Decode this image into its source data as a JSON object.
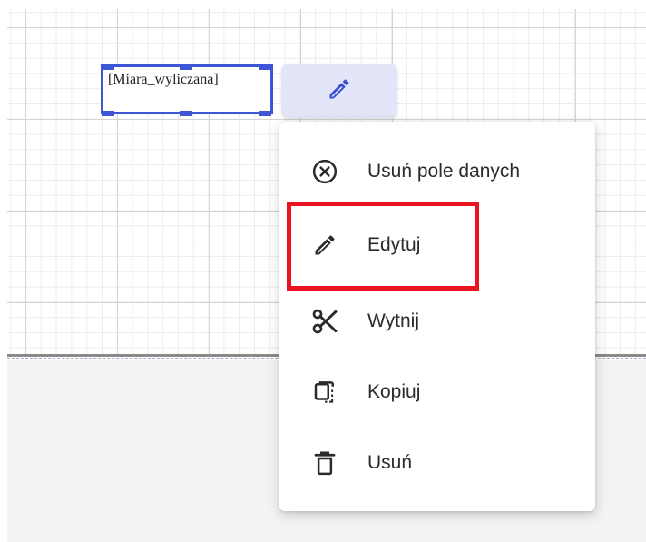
{
  "designer": {
    "field_label": "[Miara_wyliczana]",
    "edit_chip_icon": "pencil-icon"
  },
  "context_menu": {
    "items": [
      {
        "label": "Usuń pole danych",
        "icon": "remove-circle-icon"
      },
      {
        "label": "Edytuj",
        "icon": "pencil-icon"
      },
      {
        "label": "Wytnij",
        "icon": "scissors-icon"
      },
      {
        "label": "Kopiuj",
        "icon": "copy-icon"
      },
      {
        "label": "Usuń",
        "icon": "trash-icon"
      }
    ]
  },
  "colors": {
    "selection": "#3d56d6",
    "edit_chip_bg": "#e3e5f8",
    "highlight": "#e8141f",
    "edit_icon": "#3b4fd0"
  }
}
